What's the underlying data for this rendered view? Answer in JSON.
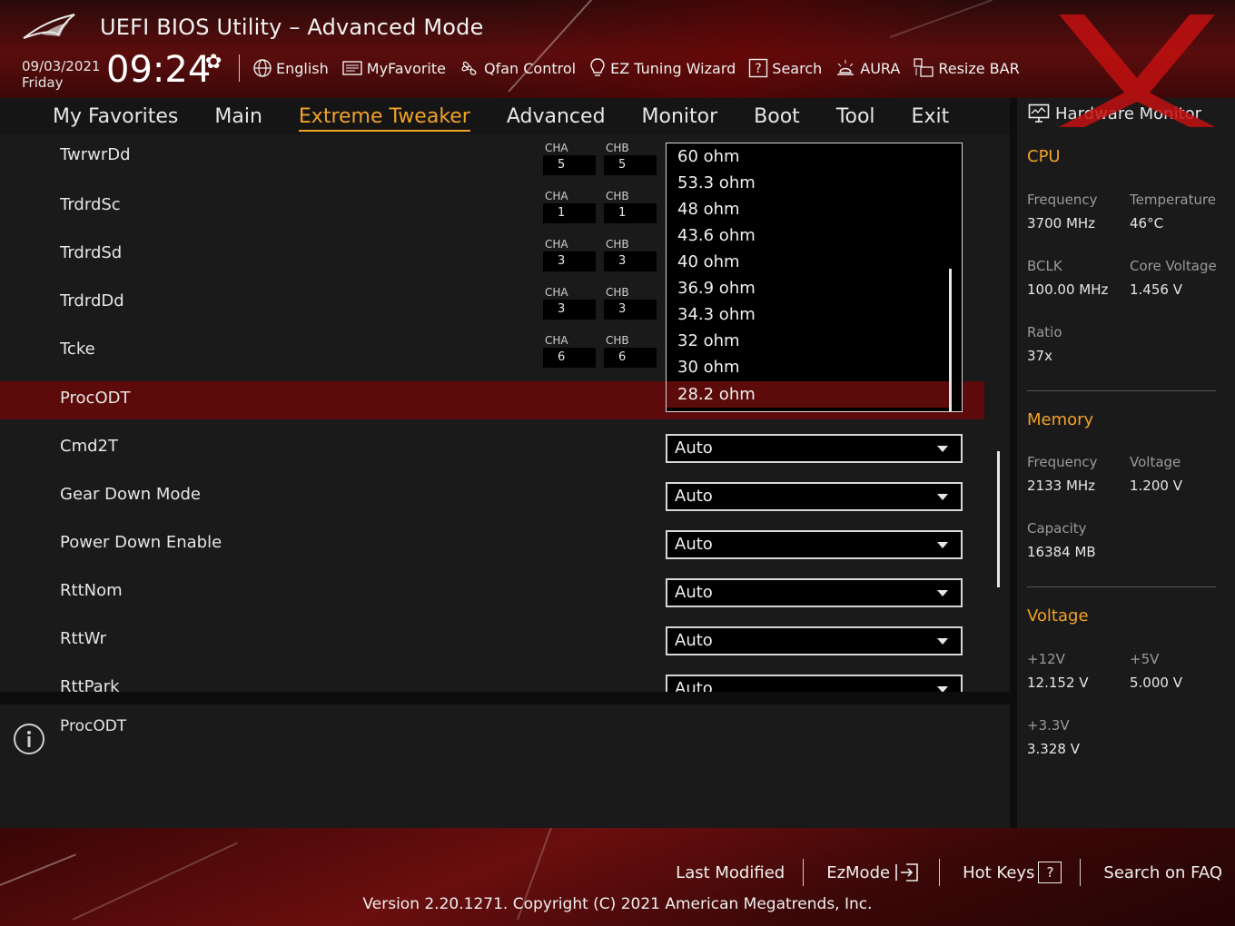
{
  "header": {
    "title": "UEFI BIOS Utility – Advanced Mode",
    "date": "09/03/2021",
    "day": "Friday",
    "time": "09:24",
    "toolbar": [
      {
        "label": "English",
        "icon": "globe-icon"
      },
      {
        "label": "MyFavorite",
        "icon": "favorite-icon"
      },
      {
        "label": "Qfan Control",
        "icon": "fan-icon"
      },
      {
        "label": "EZ Tuning Wizard",
        "icon": "bulb-icon"
      },
      {
        "label": "Search",
        "icon": "question-box-icon"
      },
      {
        "label": "AURA",
        "icon": "aura-icon"
      },
      {
        "label": "Resize BAR",
        "icon": "resize-bar-icon"
      }
    ]
  },
  "tabs": [
    {
      "label": "My Favorites",
      "active": false
    },
    {
      "label": "Main",
      "active": false
    },
    {
      "label": "Extreme Tweaker",
      "active": true
    },
    {
      "label": "Advanced",
      "active": false
    },
    {
      "label": "Monitor",
      "active": false
    },
    {
      "label": "Boot",
      "active": false
    },
    {
      "label": "Tool",
      "active": false
    },
    {
      "label": "Exit",
      "active": false
    }
  ],
  "channel_labels": {
    "a": "CHA",
    "b": "CHB"
  },
  "rows": [
    {
      "label": "TwrwrDd",
      "cha": "5",
      "chb": "5"
    },
    {
      "label": "TrdrdSc",
      "cha": "1",
      "chb": "1"
    },
    {
      "label": "TrdrdSd",
      "cha": "3",
      "chb": "3"
    },
    {
      "label": "TrdrdDd",
      "cha": "3",
      "chb": "3"
    },
    {
      "label": "Tcke",
      "cha": "6",
      "chb": "6"
    },
    {
      "label": "ProcODT",
      "selected": true
    },
    {
      "label": "Cmd2T",
      "value": "Auto"
    },
    {
      "label": "Gear Down Mode",
      "value": "Auto"
    },
    {
      "label": "Power Down Enable",
      "value": "Auto"
    },
    {
      "label": "RttNom",
      "value": "Auto"
    },
    {
      "label": "RttWr",
      "value": "Auto"
    },
    {
      "label": "RttPark",
      "value": "Auto"
    }
  ],
  "dropdown": {
    "options": [
      "60 ohm",
      "53.3 ohm",
      "48 ohm",
      "43.6 ohm",
      "40 ohm",
      "36.9 ohm",
      "34.3 ohm",
      "32 ohm",
      "30 ohm",
      "28.2 ohm"
    ],
    "selected": "28.2 ohm"
  },
  "help": {
    "text": "ProcODT"
  },
  "hardware_monitor": {
    "title": "Hardware Monitor",
    "cpu": {
      "heading": "CPU",
      "frequency_label": "Frequency",
      "frequency": "3700 MHz",
      "temperature_label": "Temperature",
      "temperature": "46°C",
      "bclk_label": "BCLK",
      "bclk": "100.00 MHz",
      "core_voltage_label": "Core Voltage",
      "core_voltage": "1.456 V",
      "ratio_label": "Ratio",
      "ratio": "37x"
    },
    "memory": {
      "heading": "Memory",
      "frequency_label": "Frequency",
      "frequency": "2133 MHz",
      "voltage_label": "Voltage",
      "voltage": "1.200 V",
      "capacity_label": "Capacity",
      "capacity": "16384 MB"
    },
    "voltage": {
      "heading": "Voltage",
      "v12_label": "+12V",
      "v12": "12.152 V",
      "v5_label": "+5V",
      "v5": "5.000 V",
      "v33_label": "+3.3V",
      "v33": "3.328 V"
    }
  },
  "footer": {
    "last_modified": "Last Modified",
    "ezmode": "EzMode",
    "hotkeys": "Hot Keys",
    "hotkeys_key": "?",
    "faq": "Search on FAQ",
    "version": "Version 2.20.1271. Copyright (C) 2021 American Megatrends, Inc."
  },
  "colors": {
    "accent": "#f2a227",
    "selection": "#5c0a0a",
    "header_red": "#5a0d0d"
  }
}
